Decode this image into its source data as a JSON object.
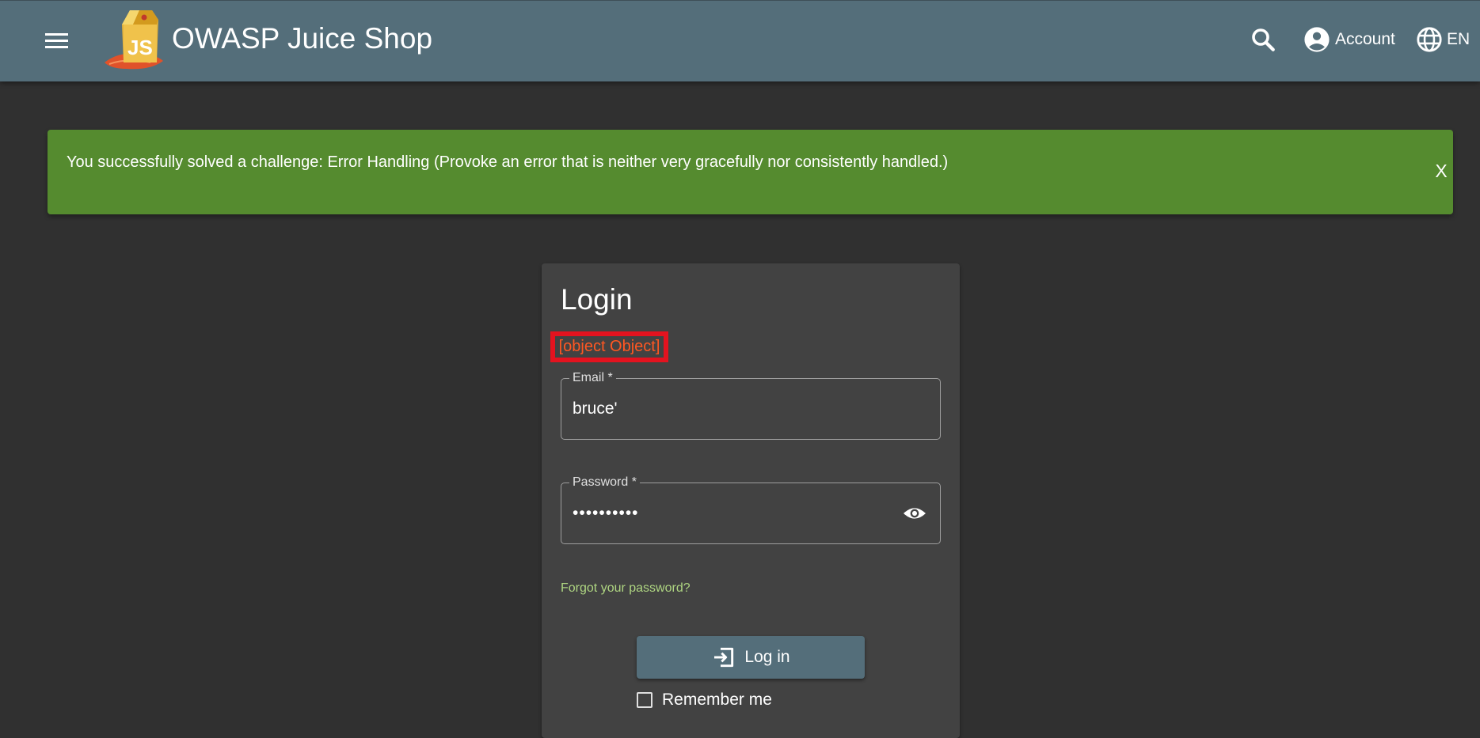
{
  "header": {
    "menu_icon": "hamburger-menu-icon",
    "logo_icon": "juice-shop-logo",
    "title": "OWASP Juice Shop",
    "search_icon": "search-icon",
    "account_icon": "account-circle-icon",
    "account_label": "Account",
    "language_icon": "globe-icon",
    "language_label": "EN"
  },
  "snackbar": {
    "message": "You successfully solved a challenge: Error Handling (Provoke an error that is neither very gracefully nor consistently handled.)",
    "close_label": "X",
    "background": "#558b2f"
  },
  "login": {
    "title": "Login",
    "error_text": "[object Object]",
    "email": {
      "label": "Email *",
      "value": "bruce'"
    },
    "password": {
      "label": "Password *",
      "value": "••••••••••",
      "visibility_icon": "eye-icon"
    },
    "forgot_link": "Forgot your password?",
    "login_button": {
      "icon": "login-arrow-icon",
      "label": "Log in"
    },
    "remember_me": {
      "label": "Remember me",
      "checked": false
    }
  },
  "colors": {
    "toolbar": "#546e7a",
    "page_background": "#303030",
    "card_background": "#424242",
    "error_text": "#ff5722",
    "error_highlight": "#e3131f",
    "link": "#aed581"
  }
}
